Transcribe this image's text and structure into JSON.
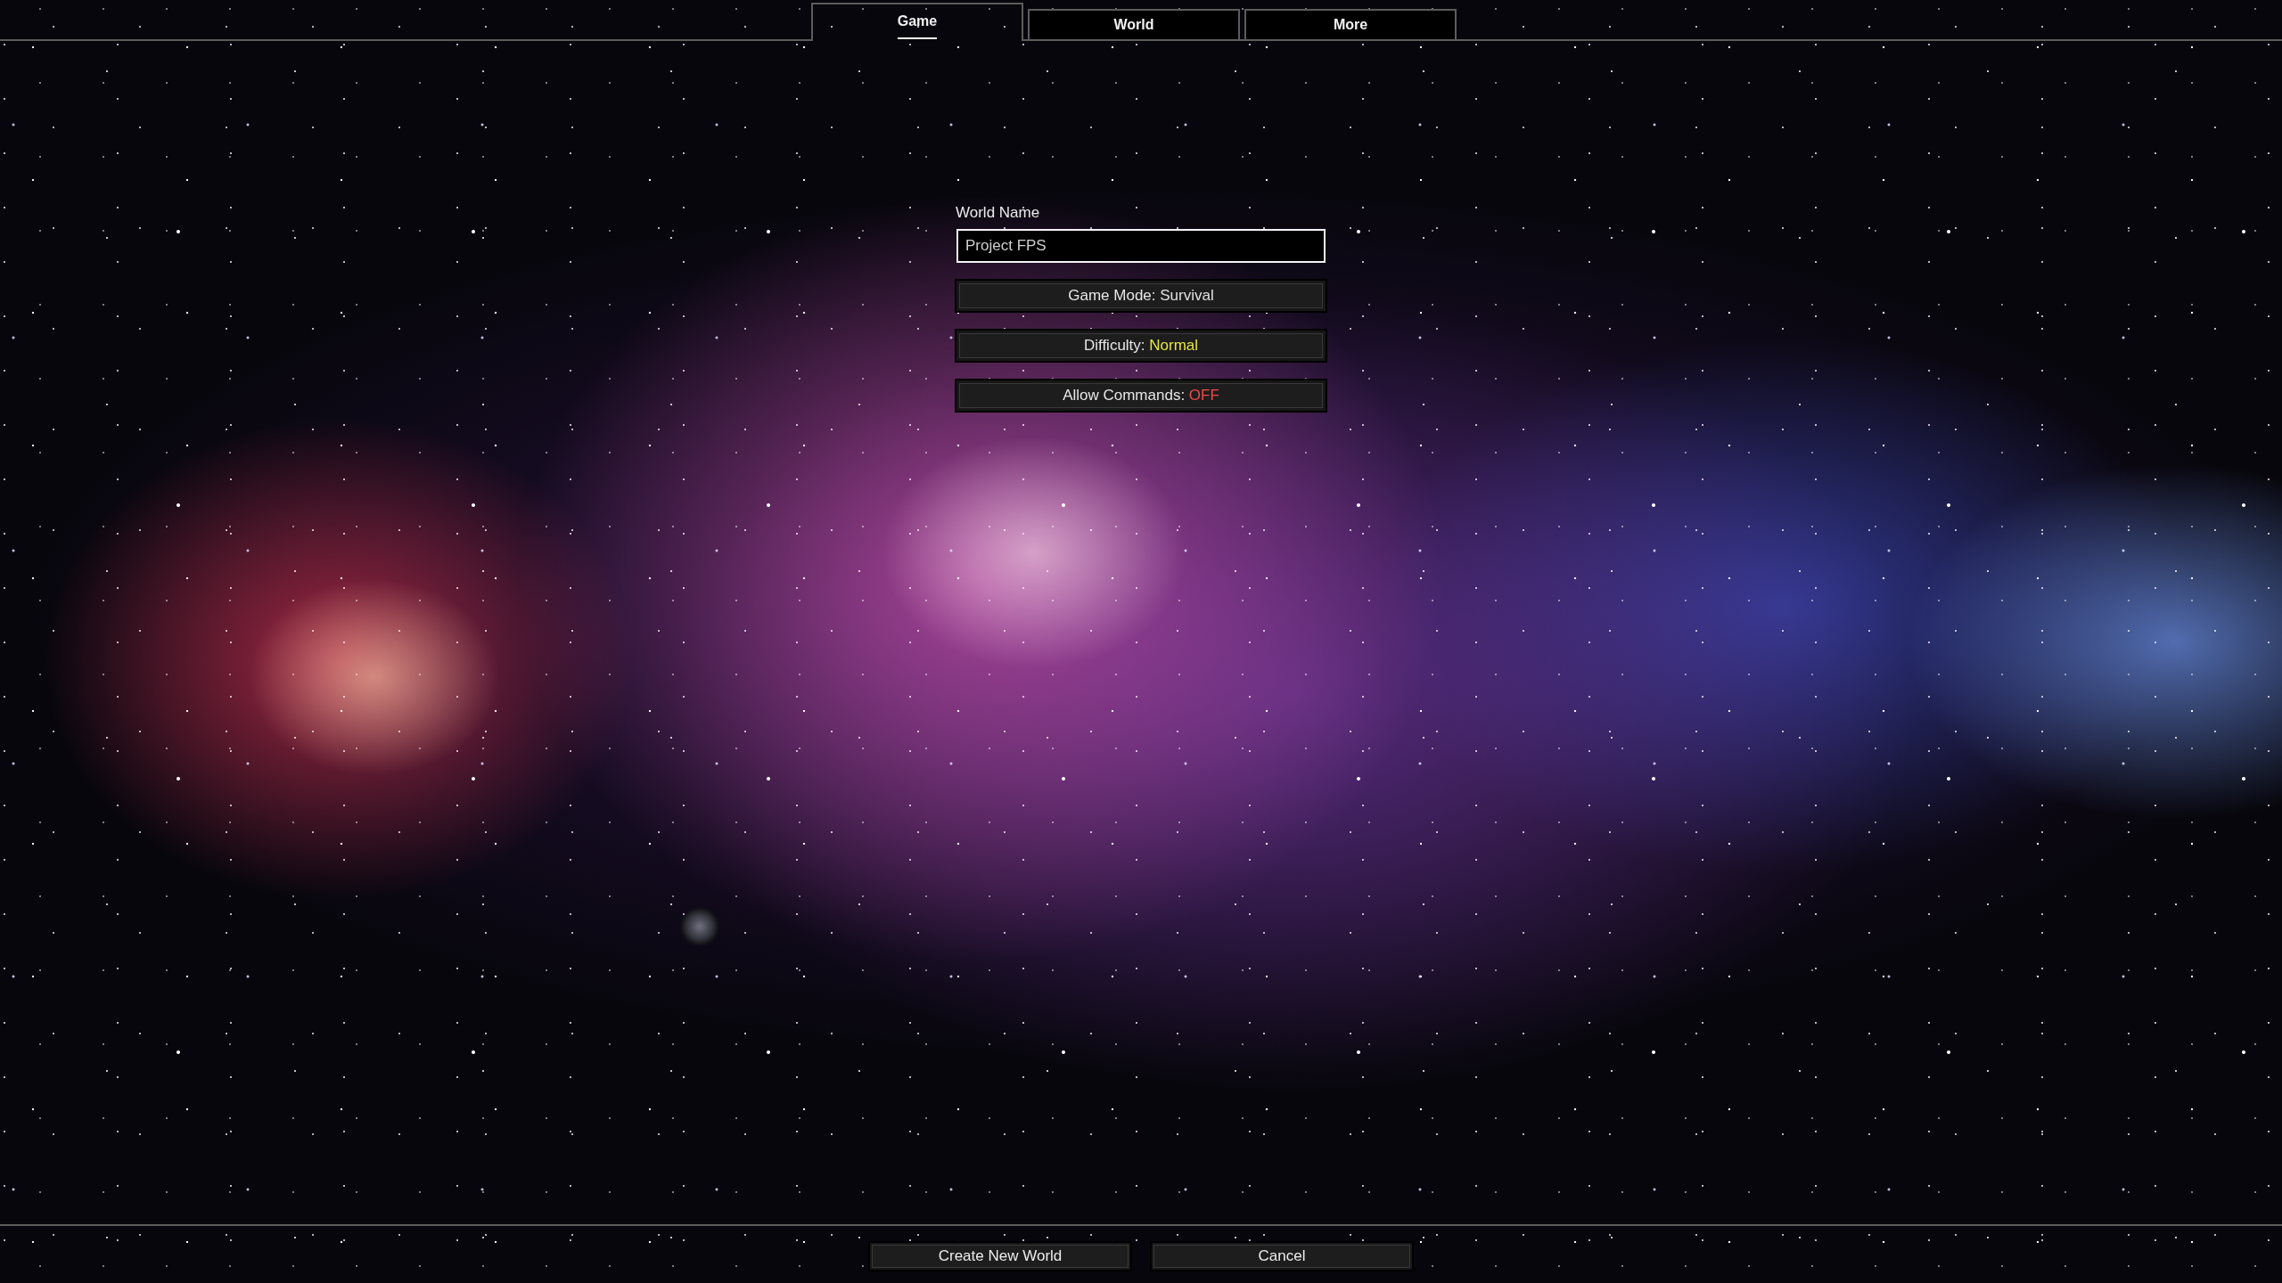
{
  "tabs": [
    {
      "label": "Game",
      "selected": true
    },
    {
      "label": "World",
      "selected": false
    },
    {
      "label": "More",
      "selected": false
    }
  ],
  "world_name": {
    "label": "World Name",
    "value": "Project FPS"
  },
  "options": [
    {
      "label": "Game Mode:",
      "value": "Survival",
      "color": "#e0e0e0"
    },
    {
      "label": "Difficulty:",
      "value": "Normal",
      "color": "#e6e63c"
    },
    {
      "label": "Allow Commands:",
      "value": "OFF",
      "color": "#f04848"
    }
  ],
  "buttons": [
    "Create New World",
    "Cancel"
  ]
}
